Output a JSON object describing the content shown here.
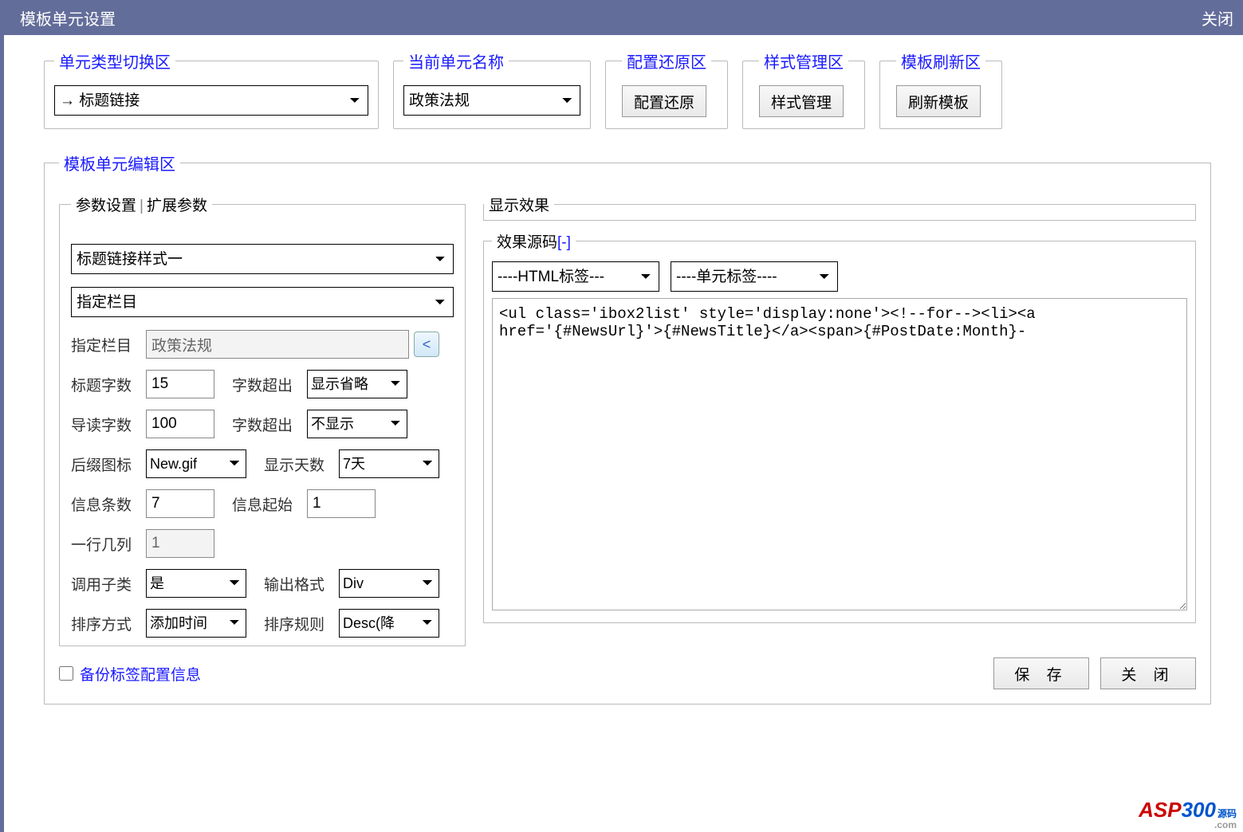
{
  "titlebar": {
    "title": "模板单元设置",
    "close": "关闭"
  },
  "toprow": {
    "type_switch": {
      "legend": "单元类型切换区",
      "value": "→ 标题链接"
    },
    "current_name": {
      "legend": "当前单元名称",
      "value": "政策法规"
    },
    "config_restore": {
      "legend": "配置还原区",
      "button": "配置还原"
    },
    "style_mgmt": {
      "legend": "样式管理区",
      "button": "样式管理"
    },
    "tpl_refresh": {
      "legend": "模板刷新区",
      "button": "刷新模板"
    }
  },
  "edit_legend": "模板单元编辑区",
  "params": {
    "tab1": "参数设置",
    "tab2": "扩展参数",
    "style_select": "标题链接样式一",
    "column_select": "指定栏目",
    "rows": {
      "specify_col": {
        "label": "指定栏目",
        "value": "政策法规"
      },
      "title_len": {
        "label": "标题字数",
        "value": "15",
        "label2": "字数超出",
        "value2": "显示省略"
      },
      "intro_len": {
        "label": "导读字数",
        "value": "100",
        "label2": "字数超出",
        "value2": "不显示"
      },
      "suffix_icon": {
        "label": "后缀图标",
        "value": "New.gif",
        "label2": "显示天数",
        "value2": "7天"
      },
      "info_count": {
        "label": "信息条数",
        "value": "7",
        "label2": "信息起始",
        "value2": "1"
      },
      "cols_per": {
        "label": "一行几列",
        "value": "1"
      },
      "call_sub": {
        "label": "调用子类",
        "value": "是",
        "label2": "输出格式",
        "value2": "Div"
      },
      "sort_by": {
        "label": "排序方式",
        "value": "添加时间",
        "label2": "排序规则",
        "value2": "Desc(降"
      }
    }
  },
  "right": {
    "display_legend": "显示效果",
    "src_legend": "效果源码",
    "src_toggle": "[-]",
    "html_tag_select": "----HTML标签---",
    "unit_tag_select": "----单元标签----",
    "source": "<ul class='ibox2list' style='display:none'><!--for--><li><a href='{#NewsUrl}'>{#NewsTitle}</a><span>{#PostDate:Month}-"
  },
  "footer": {
    "backup": "备份标签配置信息",
    "save": "保 存",
    "close": "关 闭"
  },
  "logo": {
    "a": "ASP",
    "b": "300",
    "tag": "源码",
    "com": ".com"
  }
}
